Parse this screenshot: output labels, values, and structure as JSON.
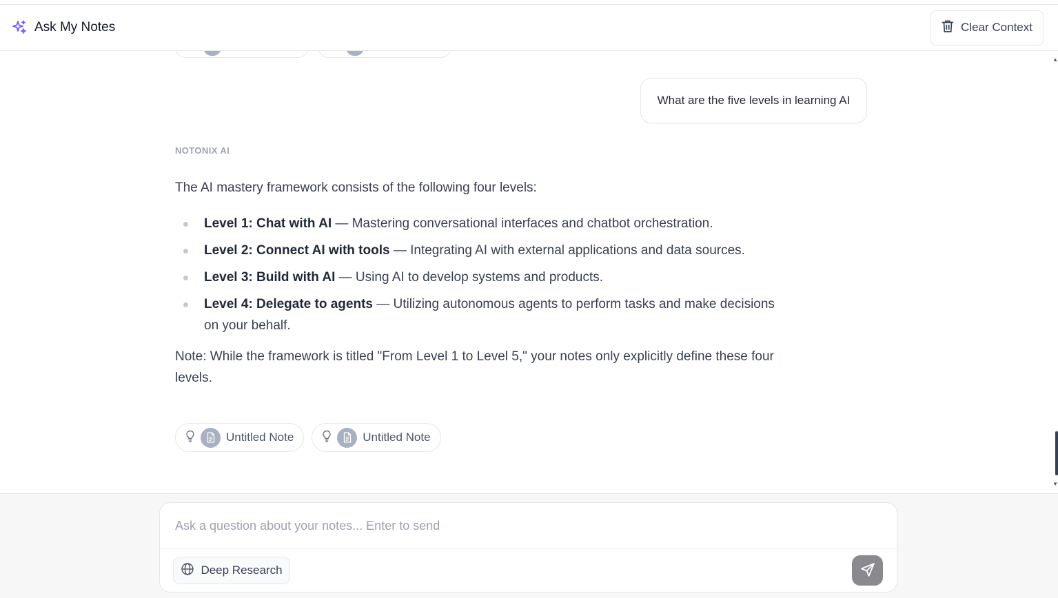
{
  "header": {
    "app_title": "Ask My Notes",
    "clear_label": "Clear Context"
  },
  "chat": {
    "user_message": "What are the five levels in learning AI",
    "ai_label": "NOTONIX AI",
    "ai_intro": "The AI mastery framework consists of the following four levels:",
    "levels": [
      {
        "title": "Level 1: Chat with AI",
        "desc": " — Mastering conversational interfaces and chatbot orchestration."
      },
      {
        "title": "Level 2: Connect AI with tools",
        "desc": " — Integrating AI with external applications and data sources."
      },
      {
        "title": "Level 3: Build with AI",
        "desc": " — Using AI to develop systems and products."
      },
      {
        "title": "Level 4: Delegate to agents",
        "desc": " — Utilizing autonomous agents to perform tasks and make decisions on your behalf."
      }
    ],
    "ai_note": "Note: While the framework is titled \"From Level 1 to Level 5,\" your notes only explicitly define these four levels.",
    "sources": [
      {
        "label": "Untitled Note"
      },
      {
        "label": "Untitled Note"
      }
    ]
  },
  "composer": {
    "placeholder": "Ask a question about your notes... Enter to send",
    "deep_research_label": "Deep Research"
  },
  "colors": {
    "accent": "#7c5cff",
    "send_button": "#8a8a8e",
    "doc_badge": "#a7b1c2"
  },
  "icons": {
    "app": "sparkle-icon",
    "clear": "trash-icon",
    "source_hint": "lightbulb-icon",
    "source_doc": "document-icon",
    "deep_research": "globe-icon",
    "send": "send-icon"
  }
}
